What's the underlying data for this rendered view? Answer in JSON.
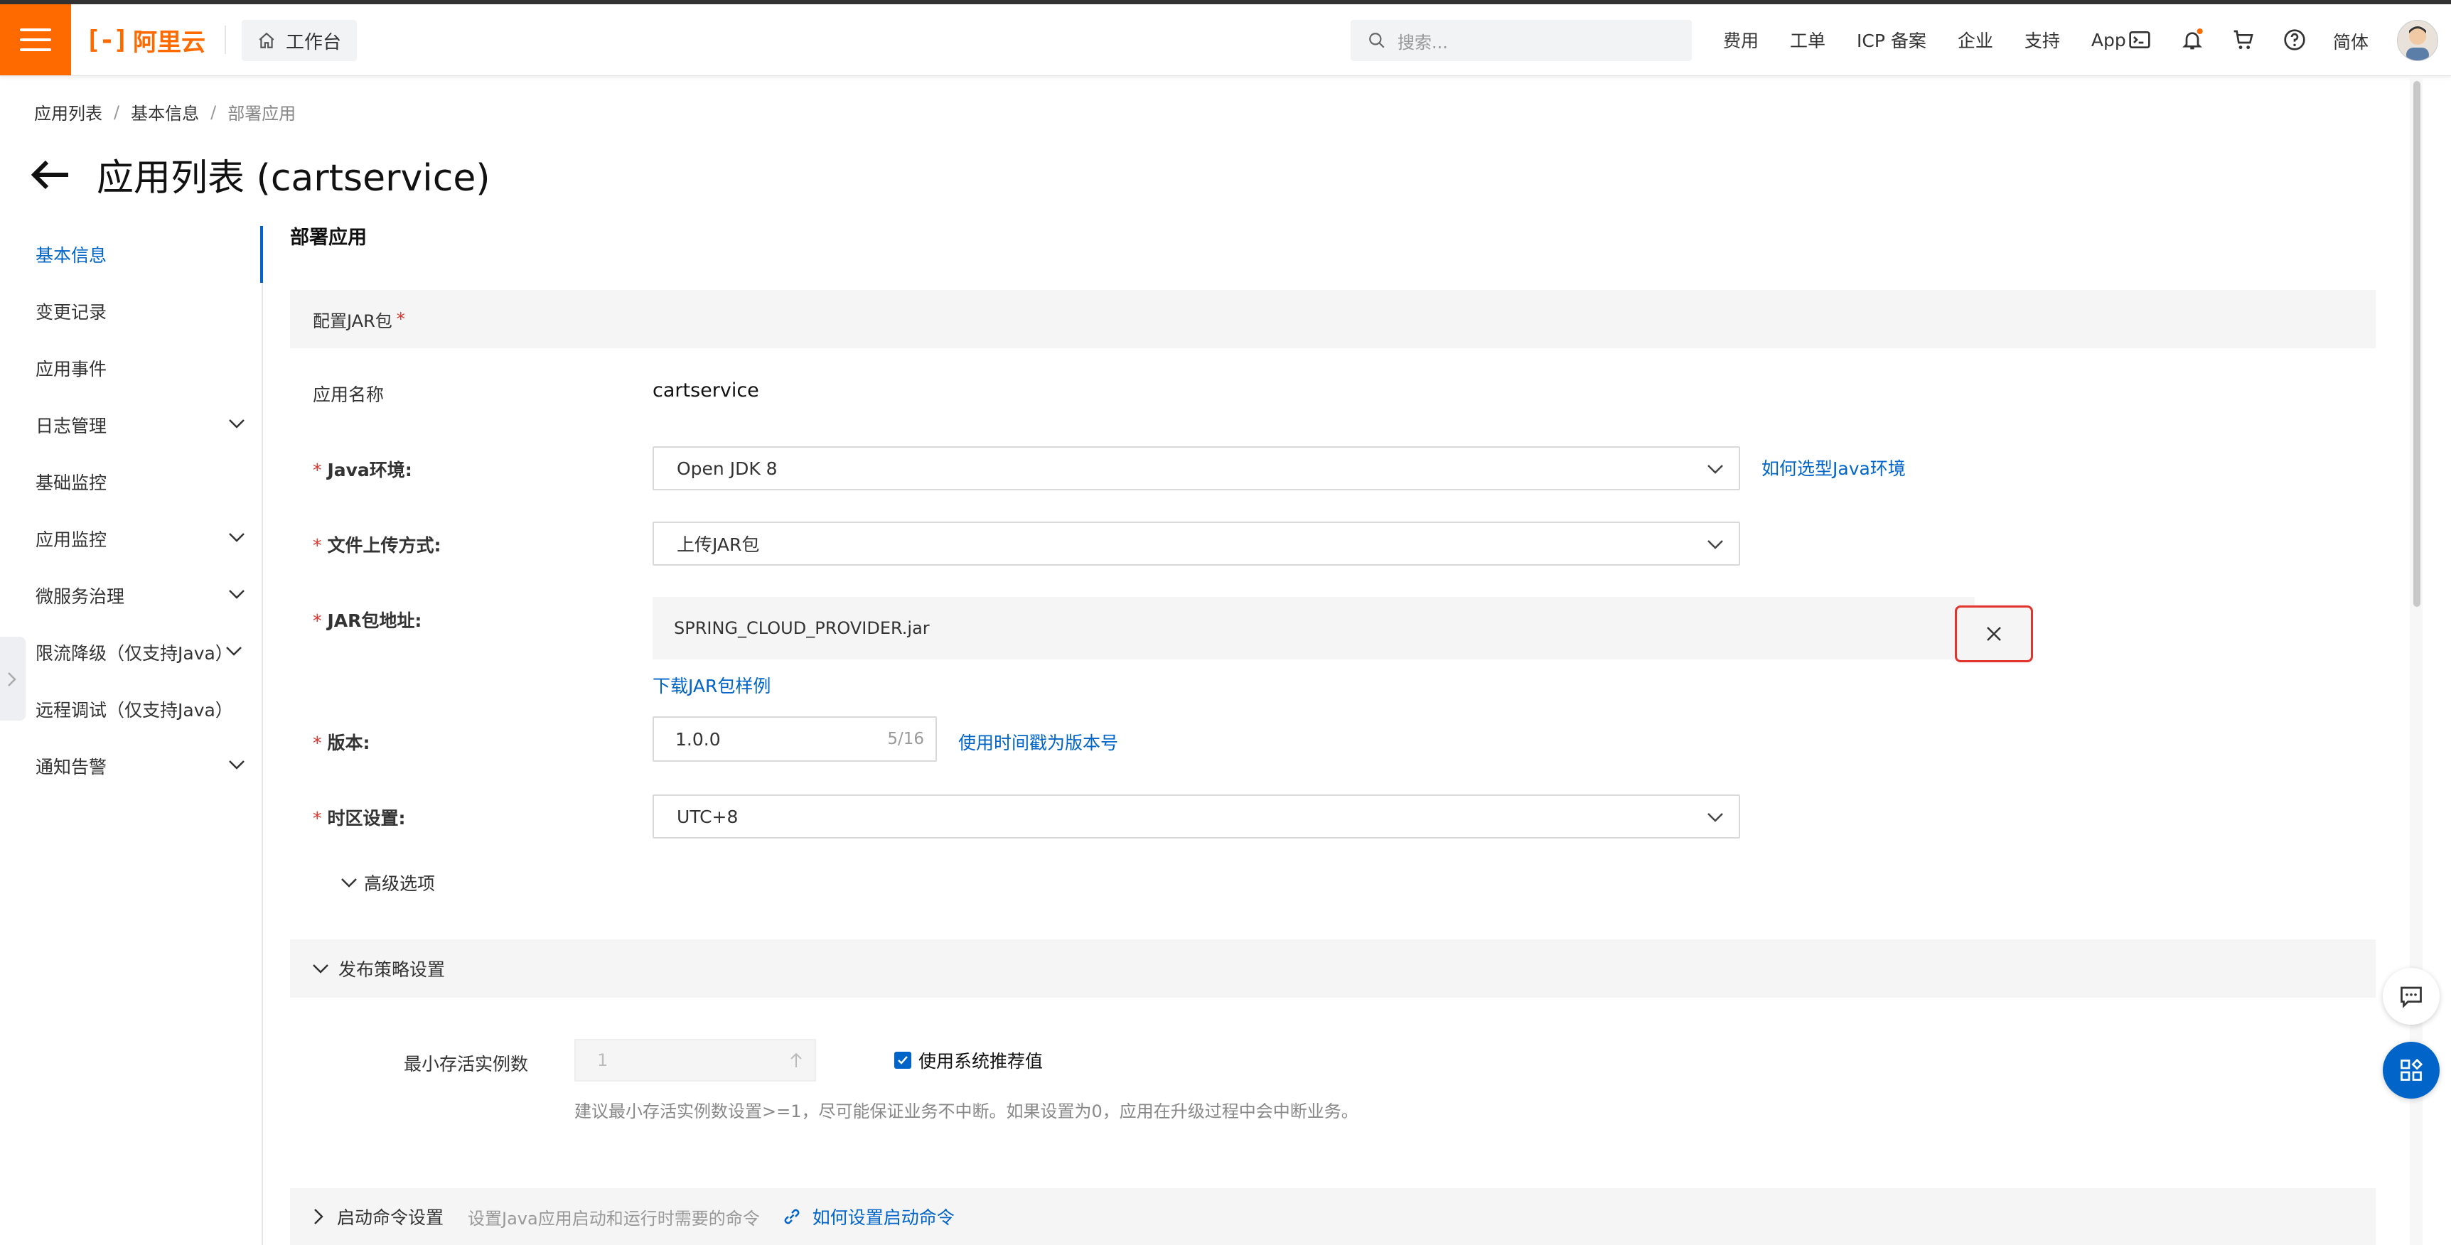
{
  "topbar": {
    "logo_text": "阿里云",
    "workbench_label": "工作台",
    "search_placeholder": "搜索...",
    "nav": [
      "费用",
      "工单",
      "ICP 备案",
      "企业",
      "支持",
      "App"
    ],
    "lang": "简体"
  },
  "breadcrumb": [
    "应用列表",
    "基本信息",
    "部署应用"
  ],
  "page_title": "应用列表 (cartservice)",
  "sidenav": [
    {
      "label": "基本信息",
      "active": true,
      "expandable": false
    },
    {
      "label": "变更记录",
      "active": false,
      "expandable": false
    },
    {
      "label": "应用事件",
      "active": false,
      "expandable": false
    },
    {
      "label": "日志管理",
      "active": false,
      "expandable": true
    },
    {
      "label": "基础监控",
      "active": false,
      "expandable": false
    },
    {
      "label": "应用监控",
      "active": false,
      "expandable": true
    },
    {
      "label": "微服务治理",
      "active": false,
      "expandable": true
    },
    {
      "label": "限流降级（仅支持Java）",
      "active": false,
      "expandable": true
    },
    {
      "label": "远程调试（仅支持Java）",
      "active": false,
      "expandable": false
    },
    {
      "label": "通知告警",
      "active": false,
      "expandable": true
    }
  ],
  "form": {
    "section_title": "部署应用",
    "jar_config_label": "配置JAR包",
    "app_name_label": "应用名称",
    "app_name_value": "cartservice",
    "java_env_label": "Java环境:",
    "java_env_value": "Open JDK 8",
    "java_env_link": "如何选型Java环境",
    "upload_label": "文件上传方式:",
    "upload_value": "上传JAR包",
    "jar_addr_label": "JAR包地址:",
    "jar_file": "SPRING_CLOUD_PROVIDER.jar",
    "download_sample": "下载JAR包样例",
    "version_label": "版本:",
    "version_value": "1.0.0",
    "version_count": "5/16",
    "version_link": "使用时间戳为版本号",
    "timezone_label": "时区设置:",
    "timezone_value": "UTC+8",
    "advanced": "高级选项",
    "release_strategy": "发布策略设置",
    "min_instances_label": "最小存活实例数",
    "min_instances_value": "1",
    "use_recommended": "使用系统推荐值",
    "min_instances_hint": "建议最小存活实例数设置>=1，尽可能保证业务不中断。如果设置为0，应用在升级过程中会中断业务。",
    "startup_cmd": "启动命令设置",
    "startup_cmd_desc": "设置Java应用启动和运行时需要的命令",
    "startup_cmd_link": "如何设置启动命令"
  },
  "colors": {
    "brand": "#ff6a00",
    "link": "#0064c8",
    "highlight_border": "#e0342c"
  }
}
